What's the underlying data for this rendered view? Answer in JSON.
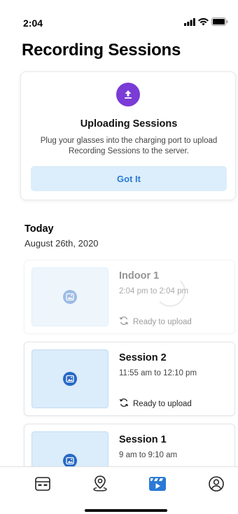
{
  "status_bar": {
    "time": "2:04"
  },
  "page": {
    "title": "Recording Sessions"
  },
  "upload_card": {
    "title": "Uploading Sessions",
    "description": "Plug your glasses into the charging port to upload Recording Sessions to the server.",
    "button_label": "Got It",
    "icon": "upload-icon"
  },
  "section": {
    "heading": "Today",
    "date": "August 26th, 2020"
  },
  "sessions": [
    {
      "name": "Indoor 1",
      "time": "2:04 pm to 2:04 pm",
      "status": "Ready to upload",
      "state": "processing"
    },
    {
      "name": "Session 2",
      "time": "11:55 am to 12:10 pm",
      "status": "Ready to upload",
      "state": "ready"
    },
    {
      "name": "Session 1",
      "time": "9 am to 9:10 am",
      "status": "",
      "state": "ready"
    }
  ],
  "tabs": [
    {
      "icon": "glasses-icon",
      "active": false
    },
    {
      "icon": "location-pin-icon",
      "active": false
    },
    {
      "icon": "video-clapper-icon",
      "active": true
    },
    {
      "icon": "profile-icon",
      "active": false
    }
  ],
  "colors": {
    "accent_blue": "#2a7ad5",
    "upload_badge": "#7a3bd6",
    "button_bg": "#dceefb",
    "thumb_bg": "#dbecfa"
  }
}
